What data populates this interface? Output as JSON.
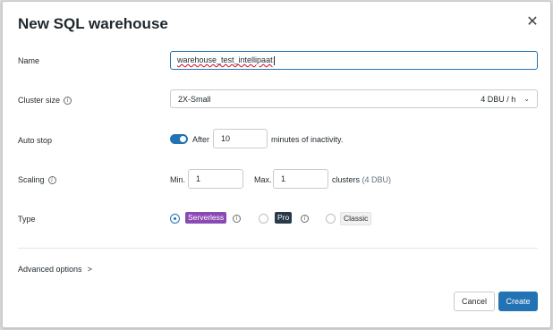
{
  "dialog": {
    "title": "New SQL warehouse",
    "close_icon": "close-icon"
  },
  "name": {
    "label": "Name",
    "value": "warehouse_test_intellipaat"
  },
  "cluster_size": {
    "label": "Cluster size",
    "selected": "2X-Small",
    "dbu": "4 DBU / h"
  },
  "auto_stop": {
    "label": "Auto stop",
    "enabled": true,
    "after_label": "After",
    "value": "10",
    "suffix": "minutes of inactivity."
  },
  "scaling": {
    "label": "Scaling",
    "min_label": "Min.",
    "min_value": "1",
    "max_label": "Max.",
    "max_value": "1",
    "clusters_label": "clusters",
    "clusters_dbu": "(4 DBU)"
  },
  "type": {
    "label": "Type",
    "options": [
      {
        "label": "Serverless",
        "selected": true
      },
      {
        "label": "Pro",
        "selected": false
      },
      {
        "label": "Classic",
        "selected": false
      }
    ]
  },
  "advanced": {
    "label": "Advanced options",
    "chevron": ">"
  },
  "footer": {
    "cancel_label": "Cancel",
    "create_label": "Create"
  },
  "colors": {
    "accent": "#2272b4",
    "serverless_tag": "#8a4ab3",
    "pro_tag": "#293a4a"
  }
}
